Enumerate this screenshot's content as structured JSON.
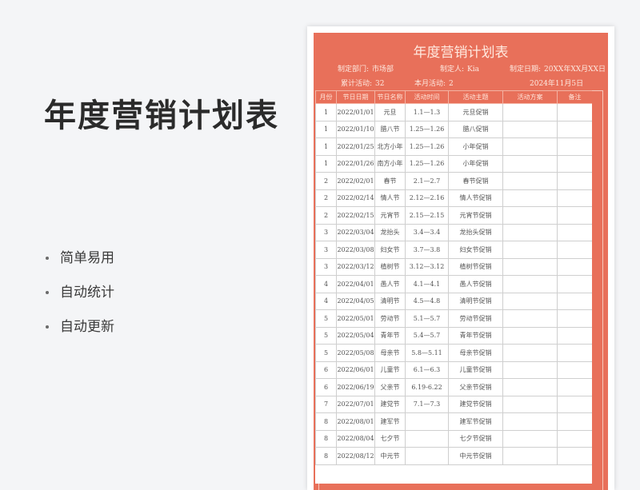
{
  "slide": {
    "title": "年度营销计划表",
    "features": [
      "简单易用",
      "自动统计",
      "自动更新"
    ]
  },
  "sheet": {
    "title": "年度营销计划表",
    "dept_label": "制定部门:",
    "dept_value": "市场部",
    "maker_label": "制定人:",
    "maker_value": "Kia",
    "date_label": "制定日期:",
    "date_value": "20XX年XX月XX日",
    "total_label": "累计活动:",
    "total_value": "32",
    "month_label": "本月活动:",
    "month_value": "2",
    "today": "2024年11月5日",
    "headers": [
      "月份",
      "节日日期",
      "节日名称",
      "活动时间",
      "活动主题",
      "活动方案",
      "备注"
    ],
    "rows": [
      [
        "1",
        "2022/01/01",
        "元旦",
        "1.1—1.3",
        "元旦促销",
        "",
        ""
      ],
      [
        "1",
        "2022/01/10",
        "腊八节",
        "1.25—1.26",
        "腊八促销",
        "",
        ""
      ],
      [
        "1",
        "2022/01/25",
        "北方小年",
        "1.25—1.26",
        "小年促销",
        "",
        ""
      ],
      [
        "1",
        "2022/01/26",
        "南方小年",
        "1.25—1.26",
        "小年促销",
        "",
        ""
      ],
      [
        "2",
        "2022/02/01",
        "春节",
        "2.1—2.7",
        "春节促销",
        "",
        ""
      ],
      [
        "2",
        "2022/02/14",
        "情人节",
        "2.12—2.16",
        "情人节促销",
        "",
        ""
      ],
      [
        "2",
        "2022/02/15",
        "元宵节",
        "2.15—2.15",
        "元宵节促销",
        "",
        ""
      ],
      [
        "3",
        "2022/03/04",
        "龙抬头",
        "3.4—3.4",
        "龙抬头促销",
        "",
        ""
      ],
      [
        "3",
        "2022/03/08",
        "妇女节",
        "3.7—3.8",
        "妇女节促销",
        "",
        ""
      ],
      [
        "3",
        "2022/03/12",
        "植树节",
        "3.12—3.12",
        "植树节促销",
        "",
        ""
      ],
      [
        "4",
        "2022/04/01",
        "愚人节",
        "4.1—4.1",
        "愚人节促销",
        "",
        ""
      ],
      [
        "4",
        "2022/04/05",
        "清明节",
        "4.5—4.8",
        "清明节促销",
        "",
        ""
      ],
      [
        "5",
        "2022/05/01",
        "劳动节",
        "5.1—5.7",
        "劳动节促销",
        "",
        ""
      ],
      [
        "5",
        "2022/05/04",
        "青年节",
        "5.4—5.7",
        "青年节促销",
        "",
        ""
      ],
      [
        "5",
        "2022/05/08",
        "母亲节",
        "5.8—5.11",
        "母亲节促销",
        "",
        ""
      ],
      [
        "6",
        "2022/06/01",
        "儿童节",
        "6.1—6.3",
        "儿童节促销",
        "",
        ""
      ],
      [
        "6",
        "2022/06/19",
        "父亲节",
        "6.19-6.22",
        "父亲节促销",
        "",
        ""
      ],
      [
        "7",
        "2022/07/01",
        "建党节",
        "7.1—7.3",
        "建党节促销",
        "",
        ""
      ],
      [
        "8",
        "2022/08/01",
        "建军节",
        "",
        "建军节促销",
        "",
        ""
      ],
      [
        "8",
        "2022/08/04",
        "七夕节",
        "",
        "七夕节促销",
        "",
        ""
      ],
      [
        "8",
        "2022/08/12",
        "中元节",
        "",
        "中元节促销",
        "",
        ""
      ]
    ]
  }
}
